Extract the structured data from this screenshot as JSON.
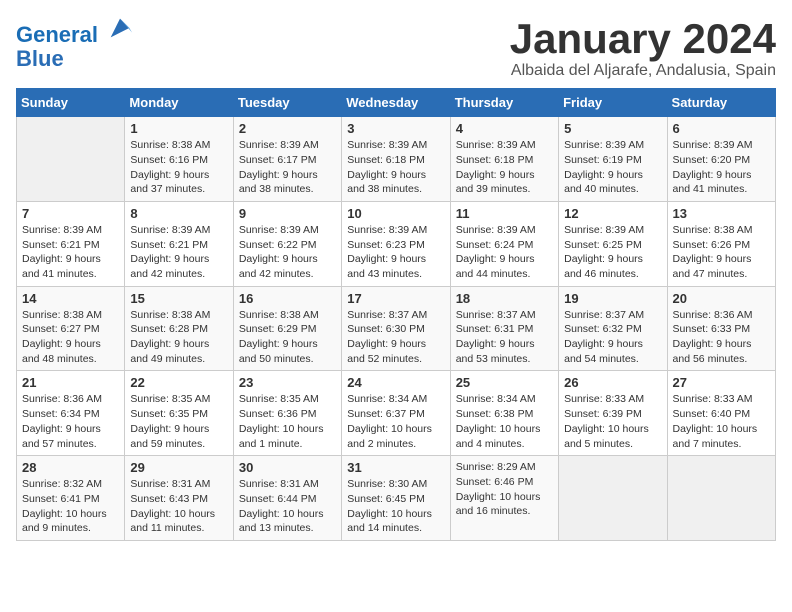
{
  "header": {
    "logo_line1": "General",
    "logo_line2": "Blue",
    "month_title": "January 2024",
    "subtitle": "Albaida del Aljarafe, Andalusia, Spain"
  },
  "weekdays": [
    "Sunday",
    "Monday",
    "Tuesday",
    "Wednesday",
    "Thursday",
    "Friday",
    "Saturday"
  ],
  "weeks": [
    [
      {
        "day": "",
        "info": ""
      },
      {
        "day": "1",
        "info": "Sunrise: 8:38 AM\nSunset: 6:16 PM\nDaylight: 9 hours\nand 37 minutes."
      },
      {
        "day": "2",
        "info": "Sunrise: 8:39 AM\nSunset: 6:17 PM\nDaylight: 9 hours\nand 38 minutes."
      },
      {
        "day": "3",
        "info": "Sunrise: 8:39 AM\nSunset: 6:18 PM\nDaylight: 9 hours\nand 38 minutes."
      },
      {
        "day": "4",
        "info": "Sunrise: 8:39 AM\nSunset: 6:18 PM\nDaylight: 9 hours\nand 39 minutes."
      },
      {
        "day": "5",
        "info": "Sunrise: 8:39 AM\nSunset: 6:19 PM\nDaylight: 9 hours\nand 40 minutes."
      },
      {
        "day": "6",
        "info": "Sunrise: 8:39 AM\nSunset: 6:20 PM\nDaylight: 9 hours\nand 41 minutes."
      }
    ],
    [
      {
        "day": "7",
        "info": ""
      },
      {
        "day": "8",
        "info": "Sunrise: 8:39 AM\nSunset: 6:21 PM\nDaylight: 9 hours\nand 42 minutes."
      },
      {
        "day": "9",
        "info": "Sunrise: 8:39 AM\nSunset: 6:22 PM\nDaylight: 9 hours\nand 42 minutes."
      },
      {
        "day": "10",
        "info": "Sunrise: 8:39 AM\nSunset: 6:23 PM\nDaylight: 9 hours\nand 43 minutes."
      },
      {
        "day": "11",
        "info": "Sunrise: 8:39 AM\nSunset: 6:24 PM\nDaylight: 9 hours\nand 44 minutes."
      },
      {
        "day": "12",
        "info": "Sunrise: 8:39 AM\nSunset: 6:25 PM\nDaylight: 9 hours\nand 46 minutes."
      },
      {
        "day": "13",
        "info": "Sunrise: 8:38 AM\nSunset: 6:26 PM\nDaylight: 9 hours\nand 47 minutes."
      }
    ],
    [
      {
        "day": "14",
        "info": "Sunrise: 8:38 AM\nSunset: 6:27 PM\nDaylight: 9 hours\nand 48 minutes."
      },
      {
        "day": "15",
        "info": "Sunrise: 8:38 AM\nSunset: 6:28 PM\nDaylight: 9 hours\nand 49 minutes."
      },
      {
        "day": "16",
        "info": "Sunrise: 8:38 AM\nSunset: 6:29 PM\nDaylight: 9 hours\nand 50 minutes."
      },
      {
        "day": "17",
        "info": "Sunrise: 8:37 AM\nSunset: 6:30 PM\nDaylight: 9 hours\nand 52 minutes."
      },
      {
        "day": "18",
        "info": "Sunrise: 8:37 AM\nSunset: 6:31 PM\nDaylight: 9 hours\nand 53 minutes."
      },
      {
        "day": "19",
        "info": "Sunrise: 8:37 AM\nSunset: 6:32 PM\nDaylight: 9 hours\nand 54 minutes."
      },
      {
        "day": "20",
        "info": "Sunrise: 8:36 AM\nSunset: 6:33 PM\nDaylight: 9 hours\nand 56 minutes."
      }
    ],
    [
      {
        "day": "21",
        "info": "Sunrise: 8:36 AM\nSunset: 6:34 PM\nDaylight: 9 hours\nand 57 minutes."
      },
      {
        "day": "22",
        "info": "Sunrise: 8:35 AM\nSunset: 6:35 PM\nDaylight: 9 hours\nand 59 minutes."
      },
      {
        "day": "23",
        "info": "Sunrise: 8:35 AM\nSunset: 6:36 PM\nDaylight: 10 hours\nand 1 minute."
      },
      {
        "day": "24",
        "info": "Sunrise: 8:34 AM\nSunset: 6:37 PM\nDaylight: 10 hours\nand 2 minutes."
      },
      {
        "day": "25",
        "info": "Sunrise: 8:34 AM\nSunset: 6:38 PM\nDaylight: 10 hours\nand 4 minutes."
      },
      {
        "day": "26",
        "info": "Sunrise: 8:33 AM\nSunset: 6:39 PM\nDaylight: 10 hours\nand 5 minutes."
      },
      {
        "day": "27",
        "info": "Sunrise: 8:33 AM\nSunset: 6:40 PM\nDaylight: 10 hours\nand 7 minutes."
      }
    ],
    [
      {
        "day": "28",
        "info": "Sunrise: 8:32 AM\nSunset: 6:41 PM\nDaylight: 10 hours\nand 9 minutes."
      },
      {
        "day": "29",
        "info": "Sunrise: 8:31 AM\nSunset: 6:43 PM\nDaylight: 10 hours\nand 11 minutes."
      },
      {
        "day": "30",
        "info": "Sunrise: 8:31 AM\nSunset: 6:44 PM\nDaylight: 10 hours\nand 13 minutes."
      },
      {
        "day": "31",
        "info": "Sunrise: 8:30 AM\nSunset: 6:45 PM\nDaylight: 10 hours\nand 14 minutes."
      },
      {
        "day": "",
        "info": "Sunrise: 8:29 AM\nSunset: 6:46 PM\nDaylight: 10 hours\nand 16 minutes."
      },
      {
        "day": "",
        "info": ""
      },
      {
        "day": "",
        "info": ""
      }
    ]
  ]
}
